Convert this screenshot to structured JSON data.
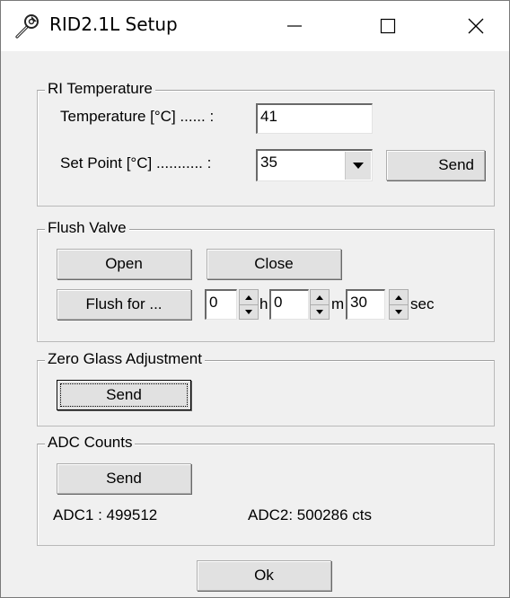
{
  "window": {
    "title": "RID2.1L Setup",
    "icon": "wrench-icon"
  },
  "ri_temperature": {
    "group_label": "RI Temperature",
    "temperature_label": "Temperature [°C] ...... :",
    "temperature_value": "41",
    "setpoint_label": "Set Point [°C] ........... :",
    "setpoint_value": "35",
    "send_label": "Send"
  },
  "flush_valve": {
    "group_label": "Flush Valve",
    "open_label": "Open",
    "close_label": "Close",
    "flush_for_label": "Flush for ...",
    "hours_value": "0",
    "hours_unit": "h",
    "minutes_value": "0",
    "minutes_unit": "m",
    "seconds_value": "30",
    "seconds_unit": "sec"
  },
  "zero_glass": {
    "group_label": "Zero Glass Adjustment",
    "send_label": "Send"
  },
  "adc_counts": {
    "group_label": "ADC Counts",
    "send_label": "Send",
    "adc1_text": "ADC1 : 499512",
    "adc2_text": "ADC2: 500286 cts"
  },
  "footer": {
    "ok_label": "Ok"
  }
}
